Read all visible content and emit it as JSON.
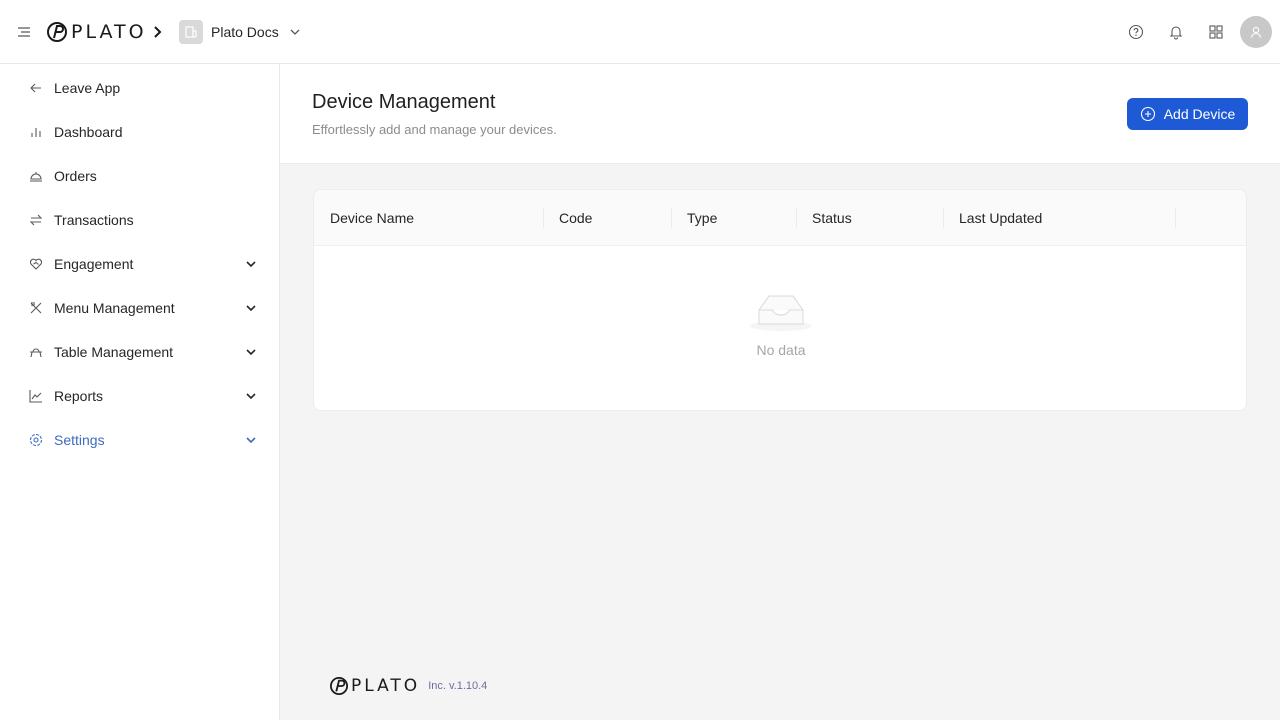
{
  "header": {
    "brand": "PLATO",
    "org_name": "Plato Docs",
    "icons": [
      "help-icon",
      "bell-icon",
      "apps-grid-icon",
      "user-avatar-icon"
    ]
  },
  "sidebar": {
    "items": [
      {
        "label": "Leave App",
        "icon": "arrow-left-icon",
        "expandable": false
      },
      {
        "label": "Dashboard",
        "icon": "bar-chart-icon",
        "expandable": false
      },
      {
        "label": "Orders",
        "icon": "cloche-icon",
        "expandable": false
      },
      {
        "label": "Transactions",
        "icon": "swap-arrows-icon",
        "expandable": false
      },
      {
        "label": "Engagement",
        "icon": "heart-handshake-icon",
        "expandable": true
      },
      {
        "label": "Menu Management",
        "icon": "utensils-icon",
        "expandable": true
      },
      {
        "label": "Table Management",
        "icon": "table-icon",
        "expandable": true
      },
      {
        "label": "Reports",
        "icon": "line-chart-icon",
        "expandable": true
      },
      {
        "label": "Settings",
        "icon": "gear-icon",
        "expandable": true,
        "active": true
      }
    ]
  },
  "page": {
    "title": "Device Management",
    "subtitle": "Effortlessly add and manage your devices.",
    "add_button": "Add Device"
  },
  "table": {
    "columns": [
      "Device Name",
      "Code",
      "Type",
      "Status",
      "Last Updated"
    ],
    "rows": [],
    "empty_text": "No data"
  },
  "footer": {
    "brand": "PLATO",
    "version": "Inc. v.1.10.4"
  },
  "colors": {
    "primary": "#1f5ad6",
    "active_nav": "#3c6bbf"
  }
}
